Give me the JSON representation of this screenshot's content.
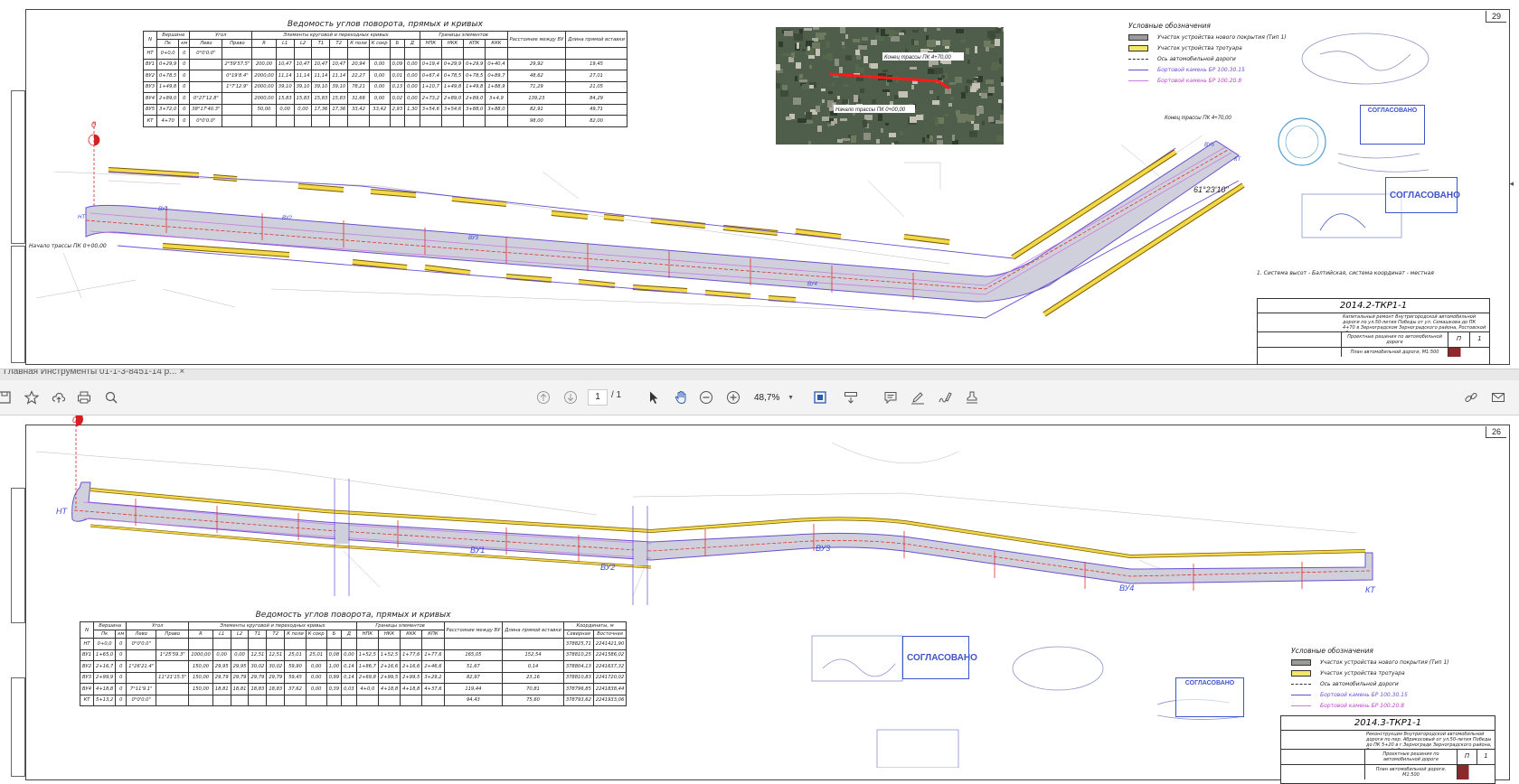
{
  "pages": [
    {
      "number": "29",
      "vedomost": {
        "title": "Ведомость углов поворота, прямых и кривых",
        "header_groups": [
          "N",
          "Вершина",
          "Угол",
          "Элементы круговой и переходных кривых",
          "Границы элементов",
          "Расстояние между ВУ",
          "Длина прямой вставки"
        ],
        "sub_headers": [
          "Пк",
          "км",
          "Лево",
          "Право",
          "R",
          "L1",
          "L2",
          "T1",
          "T2",
          "К поли",
          "К сокр",
          "Б",
          "Д",
          "НПК",
          "НКК",
          "КПК",
          "ККК"
        ],
        "rows": [
          [
            "НТ",
            "0+0,0",
            "0",
            "0°0'0.0\"",
            "",
            "",
            "",
            "",
            "",
            "",
            "",
            "",
            "",
            "",
            "",
            "",
            "",
            ""
          ],
          [
            "ВУ1",
            "0+29,9",
            "0",
            "",
            "2°59'57.5\"",
            "200,00",
            "10,47",
            "10,47",
            "10,47",
            "10,47",
            "20,94",
            "0,00",
            "0,09",
            "0,00",
            "0+19,4",
            "0+29,9",
            "0+29,9",
            "0+40,4"
          ],
          [
            "ВУ2",
            "0+78,5",
            "0",
            "",
            "0°19'8.4\"",
            "2000,00",
            "11,14",
            "11,14",
            "11,14",
            "11,14",
            "22,27",
            "0,00",
            "0,01",
            "0,00",
            "0+67,4",
            "0+78,5",
            "0+78,5",
            "0+89,7"
          ],
          [
            "ВУ3",
            "1+49,8",
            "0",
            "",
            "1°7'12.9\"",
            "2000,00",
            "39,10",
            "39,10",
            "39,10",
            "39,10",
            "78,21",
            "0,00",
            "0,13",
            "0,00",
            "1+10,7",
            "1+49,8",
            "1+49,8",
            "1+88,9"
          ],
          [
            "ВУ4",
            "2+89,0",
            "0",
            "0°27'12.8\"",
            "",
            "2000,00",
            "15,83",
            "15,83",
            "15,83",
            "15,83",
            "31,66",
            "0,00",
            "0,02",
            "0,00",
            "2+73,2",
            "2+89,0",
            "2+89,0",
            "3+4,9"
          ],
          [
            "ВУ5",
            "3+72,0",
            "0",
            "38°17'40.3\"",
            "",
            "50,00",
            "0,00",
            "0,00",
            "17,36",
            "17,36",
            "33,42",
            "33,42",
            "2,93",
            "1,30",
            "3+54,6",
            "3+54,6",
            "3+88,0",
            "3+88,0"
          ],
          [
            "КТ",
            "4+70",
            "0",
            "0°0'0.0\"",
            "",
            "",
            "",
            "",
            "",
            "",
            "",
            "",
            "",
            "",
            "",
            "",
            "",
            ""
          ]
        ],
        "distances": [
          "29,92",
          "48,62",
          "71,29",
          "139,23",
          "82,91",
          "98,00"
        ],
        "straights": [
          "19,45",
          "27,01",
          "21,05",
          "84,29",
          "49,71",
          "82,00"
        ]
      },
      "aerial_labels": [
        "Конец трассы ПК 4+70,00",
        "Начало трассы ПК 0+00,00"
      ],
      "legend": {
        "title": "Условные обозначения",
        "items": [
          "Участок устройства нового покрытия (Тип 1)",
          "Участок устройства тротуара",
          "Ось автомобильной дороги",
          "Бортовой камень БР 100.30.15",
          "Бортовой камень БР 100.20.8"
        ]
      },
      "end_label": "Конец трассы ПК 4+70,00",
      "start_label": "Начало трассы ПК 0+00,00",
      "angle_label": "61°23'10\"",
      "note": "1. Система высот - Балтийская, система координат - местная",
      "vertex_labels": [
        "НТ",
        "ВУ1",
        "ВУ2",
        "ВУ3",
        "ВУ4",
        "ВУ5",
        "КТ"
      ],
      "approve_text": "СОГЛАСОВАНО",
      "stamp": {
        "code": "2014.2-ТКР1-1",
        "desc": "Капитальный ремонт Внутригородской автомобильной дороги по ул.50-летия Победы от ул. Семашкова до ПК 4+70 в Зерноградском Зерноградского района, Ростовской области",
        "section": "Проектные решения по автомобильной дороге",
        "sheet_title": "План автомобильной дороги, М1:500",
        "stage": "П",
        "sheet": "1",
        "sheets": "1"
      }
    },
    {
      "number": "26",
      "vedomost": {
        "title": "Ведомость углов поворота, прямых и кривых",
        "header_groups": [
          "N",
          "Вершина",
          "Угол",
          "Элементы круговой и переходных кривых",
          "Границы элементов",
          "Расстояние между ВУ",
          "Длина прямой вставки",
          "Координаты, м"
        ],
        "sub_headers": [
          "Пк",
          "км",
          "Лево",
          "Право",
          "R",
          "L1",
          "L2",
          "T1",
          "T2",
          "К поли",
          "К сокр",
          "Б",
          "Д",
          "НПК",
          "НКК",
          "ККК",
          "КПК",
          "Северная",
          "Восточная"
        ],
        "rows": [
          [
            "НТ",
            "0+0,0",
            "0",
            "0°0'0.0\"",
            "",
            "",
            "",
            "",
            "",
            "",
            "",
            "",
            "",
            "",
            "",
            "",
            "",
            "",
            "378825,71",
            "2241421,90"
          ],
          [
            "ВУ1",
            "1+65,0",
            "0",
            "",
            "1°25'59.3\"",
            "1000,00",
            "0,00",
            "0,00",
            "12,51",
            "12,51",
            "25,01",
            "25,01",
            "0,08",
            "0,00",
            "1+52,5",
            "1+52,5",
            "1+77,6",
            "1+77,6",
            "378810,25",
            "2241586,02"
          ],
          [
            "ВУ2",
            "2+16,7",
            "0",
            "1°26'21.4\"",
            "",
            "150,00",
            "29,95",
            "29,95",
            "30,02",
            "30,02",
            "59,90",
            "0,00",
            "1,00",
            "0,14",
            "1+86,7",
            "2+16,6",
            "2+16,6",
            "2+46,6",
            "378804,13",
            "2241637,32"
          ],
          [
            "ВУ3",
            "2+99,9",
            "0",
            "",
            "11°21'15.5\"",
            "150,00",
            "29,79",
            "29,79",
            "29,79",
            "29,79",
            "59,45",
            "0,00",
            "0,99",
            "0,14",
            "2+69,8",
            "2+99,5",
            "2+99,5",
            "3+29,2",
            "378810,83",
            "2241720,02"
          ],
          [
            "ВУ4",
            "4+18,8",
            "0",
            "7°11'9.1\"",
            "",
            "150,00",
            "18,81",
            "18,81",
            "18,83",
            "18,83",
            "37,62",
            "0,00",
            "0,39",
            "0,03",
            "4+0,0",
            "4+18,8",
            "4+18,8",
            "4+37,6",
            "378796,85",
            "2241838,44"
          ],
          [
            "КТ",
            "5+13,2",
            "0",
            "0°0'0.0\"",
            "",
            "",
            "",
            "",
            "",
            "",
            "",
            "",
            "",
            "",
            "",
            "",
            "",
            "",
            "378793,62",
            "2241933,06"
          ]
        ],
        "distances": [
          "165,05",
          "51,67",
          "82,97",
          "119,44",
          "94,43"
        ],
        "straights": [
          "152,54",
          "0,14",
          "23,16",
          "70,81",
          "75,60"
        ]
      },
      "legend": {
        "title": "Условные обозначения",
        "items": [
          "Участок устройства нового покрытия (Тип 1)",
          "Участок устройства тротуара",
          "Ось автомобильной дороги",
          "Бортовой камень БР 100.30.15",
          "Бортовой камень БР 100.20.8"
        ]
      },
      "vertex_labels": [
        "НТ",
        "ВУ1",
        "ВУ2",
        "ВУ3",
        "ВУ4",
        "КТ"
      ],
      "approve_text": "СОГЛАСОВАНО",
      "stamp": {
        "code": "2014.3-ТКР1-1",
        "desc": "Реконструкция Внутригородской автомобильной дороги по пер. Абрикосовый от ул.50-летия Победы до ПК 5+20 в г.Зернограде Зерноградского района, Ростовской области",
        "section": "Проектные решения по автомобильной дороге",
        "sheet_title": "План автомобильной дороги, М1:500",
        "stage": "П",
        "sheet": "1",
        "sheets": "1"
      }
    }
  ],
  "toolbar": {
    "tabs_text": "Главная    Инструменты        01-1-3-8451-14 р...  ×",
    "page_current": "1",
    "page_total": "/ 1",
    "zoom": "48,7%",
    "icons_left": [
      "save-icon",
      "bookmark-star-icon",
      "upload-icon",
      "print-icon",
      "search-icon"
    ],
    "icons_center": [
      "page-up-icon",
      "page-down-icon",
      "select-cursor-icon",
      "hand-tool-icon",
      "zoom-out-icon",
      "zoom-in-icon",
      "zoom-dropdown-icon",
      "fit-page-icon",
      "scroll-mode-icon"
    ],
    "icons_right": [
      "comment-icon",
      "highlight-pen-icon",
      "sign-icon",
      "stamp-icon",
      "link-icon",
      "mail-icon"
    ]
  },
  "colors": {
    "road": "#c8c8d4",
    "sidewalk": "#f3d848",
    "curb_outer": "#6a4fd0",
    "curb_inner": "#c87ee0",
    "axis": "#e03030",
    "label_blue": "#3d4fd6",
    "label_red": "#d42020",
    "stamp_blue": "#3e54c9"
  }
}
